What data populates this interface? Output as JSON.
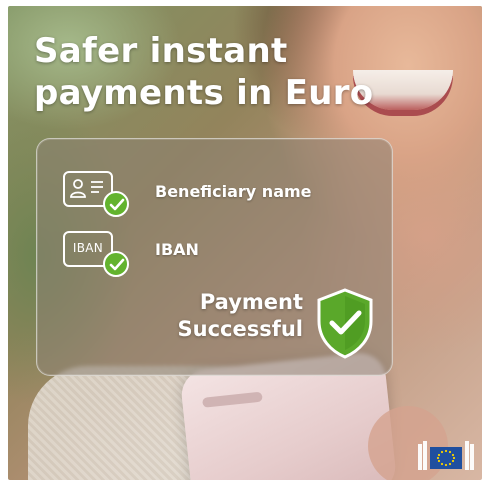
{
  "headline": {
    "line1": "Safer instant",
    "line2": "payments in Euro"
  },
  "checks": {
    "beneficiary_label": "Beneficiary name",
    "iban_icon_text": "IBAN",
    "iban_label": "IBAN"
  },
  "status": {
    "line1": "Payment",
    "line2": "Successful"
  },
  "icons": {
    "id_card": "id-card-icon",
    "iban_card": "iban-card-icon",
    "check": "check-icon",
    "shield": "shield-check-icon",
    "logo": "european-commission-logo"
  },
  "colors": {
    "check_green": "#63b32e",
    "shield_green": "#5aa82a",
    "text": "#ffffff",
    "eu_blue": "#1f4f9f",
    "eu_star": "#f5d000"
  }
}
